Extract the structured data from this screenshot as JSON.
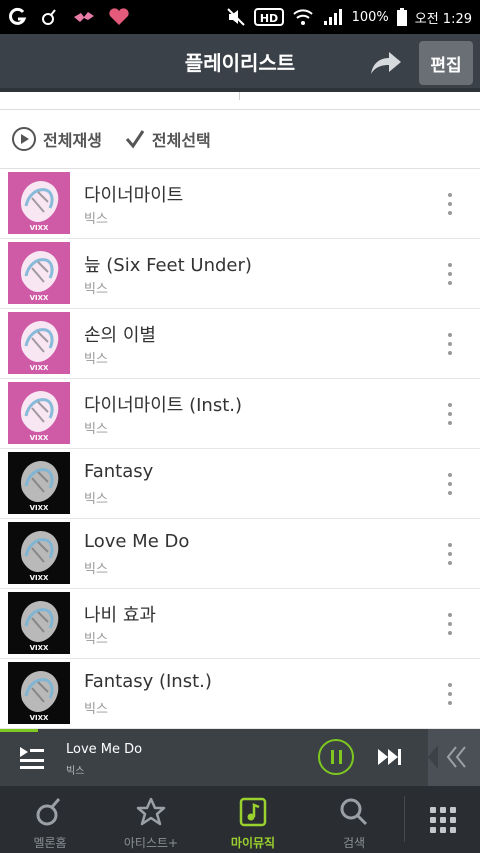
{
  "status_bar": {
    "battery": "100%",
    "time": "오전 1:29"
  },
  "header": {
    "title": "플레이리스트",
    "edit_label": "편집"
  },
  "actions": {
    "play_all": "전체재생",
    "select_all": "전체선택"
  },
  "songs": [
    {
      "title": "다이너마이트",
      "artist": "빅스",
      "cover": "pink"
    },
    {
      "title": "늪 (Six Feet Under)",
      "artist": "빅스",
      "cover": "pink"
    },
    {
      "title": "손의 이별",
      "artist": "빅스",
      "cover": "pink"
    },
    {
      "title": "다이너마이트 (Inst.)",
      "artist": "빅스",
      "cover": "pink"
    },
    {
      "title": "Fantasy",
      "artist": "빅스",
      "cover": "black"
    },
    {
      "title": "Love Me Do",
      "artist": "빅스",
      "cover": "black"
    },
    {
      "title": "나비 효과",
      "artist": "빅스",
      "cover": "black"
    },
    {
      "title": "Fantasy (Inst.)",
      "artist": "빅스",
      "cover": "black"
    }
  ],
  "cover_text": "VIXX",
  "player": {
    "title": "Love Me Do",
    "artist": "빅스",
    "progress_fraction": 0.08
  },
  "nav": {
    "items": [
      {
        "label": "멜론홈",
        "icon": "melon-home-icon",
        "active": false
      },
      {
        "label": "아티스트+",
        "icon": "star-icon",
        "active": false
      },
      {
        "label": "마이뮤직",
        "icon": "my-music-icon",
        "active": true
      },
      {
        "label": "검색",
        "icon": "search-icon",
        "active": false
      }
    ]
  },
  "colors": {
    "accent": "#9ad12e",
    "header_bg": "#3b4148",
    "player_bg": "#3c4146",
    "nav_bg": "#2a2e32",
    "cover_pink": "#cf5aa6",
    "cover_black": "#0a0a0a"
  }
}
